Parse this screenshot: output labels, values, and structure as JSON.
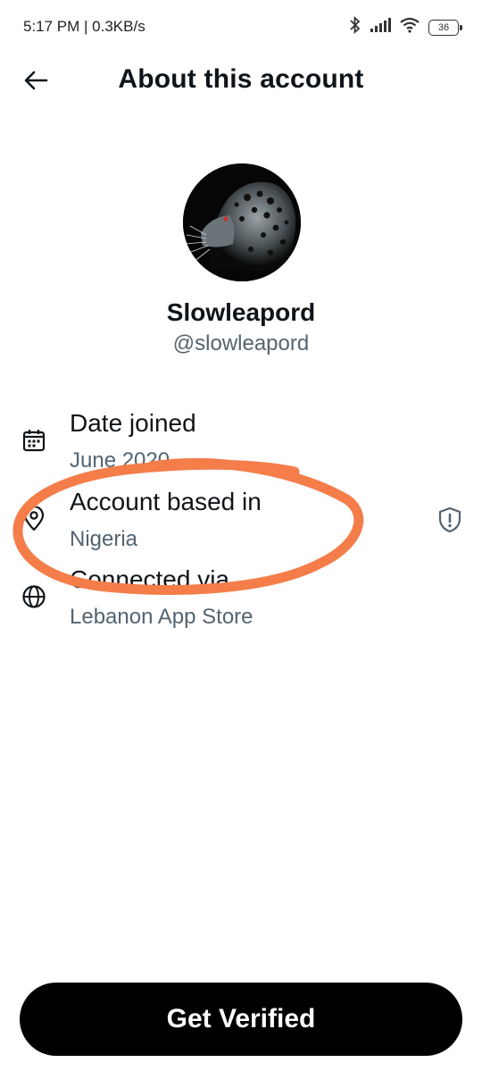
{
  "status_bar": {
    "time_speed": "5:17 PM | 0.3KB/s",
    "battery": "36",
    "icons": [
      "bluetooth-icon",
      "signal-icon",
      "wifi-icon",
      "battery-icon"
    ]
  },
  "header": {
    "title": "About this account",
    "back_icon": "back-arrow-icon"
  },
  "profile": {
    "display_name": "Slowleapord",
    "handle": "@slowleapord",
    "avatar": "leopard-avatar"
  },
  "info": {
    "date_joined": {
      "label": "Date joined",
      "value": "June 2020",
      "icon": "calendar-icon"
    },
    "account_based_in": {
      "label": "Account based in",
      "value": "Nigeria",
      "icon": "location-pin-icon",
      "action_icon": "shield-alert-icon"
    },
    "connected_via": {
      "label": "Connected via",
      "value": "Lebanon App Store",
      "icon": "globe-icon"
    }
  },
  "cta": {
    "label": "Get Verified"
  },
  "colors": {
    "primary_text": "#0f1419",
    "secondary_text": "#536471",
    "annotation": "#f47d4a",
    "button_bg": "#000000"
  }
}
